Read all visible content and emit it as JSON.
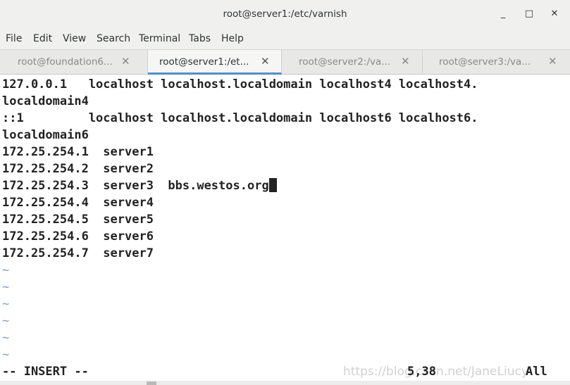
{
  "window": {
    "title": "root@server1:/etc/varnish",
    "minimize_glyph": "_",
    "maximize_glyph": "□",
    "close_glyph": "✕"
  },
  "menu": {
    "items": [
      "File",
      "Edit",
      "View",
      "Search",
      "Terminal",
      "Tabs",
      "Help"
    ]
  },
  "tabs": [
    {
      "label": "root@foundation6...",
      "close": "✕",
      "active": false
    },
    {
      "label": "root@server1:/et...",
      "close": "✕",
      "active": true
    },
    {
      "label": "root@server2:/va...",
      "close": "✕",
      "active": false
    },
    {
      "label": "root@server3:/va...",
      "close": "✕",
      "active": false
    }
  ],
  "terminal": {
    "lines": [
      "127.0.0.1   localhost localhost.localdomain localhost4 localhost4.",
      "localdomain4",
      "::1         localhost localhost.localdomain localhost6 localhost6.",
      "localdomain6",
      "172.25.254.1  server1",
      "172.25.254.2  server2",
      "172.25.254.3  server3  bbs.westos.org",
      "172.25.254.4  server4",
      "172.25.254.5  server5",
      "172.25.254.6  server6",
      "172.25.254.7  server7"
    ],
    "tilde": "~",
    "mode": "-- INSERT --",
    "position": "5,38",
    "scroll": "All",
    "watermark": "https://blog.csdn.net/JaneLiucy"
  },
  "colors": {
    "accent": "#4a90d9",
    "tilde": "#6fa3d8",
    "text": "#222222"
  }
}
